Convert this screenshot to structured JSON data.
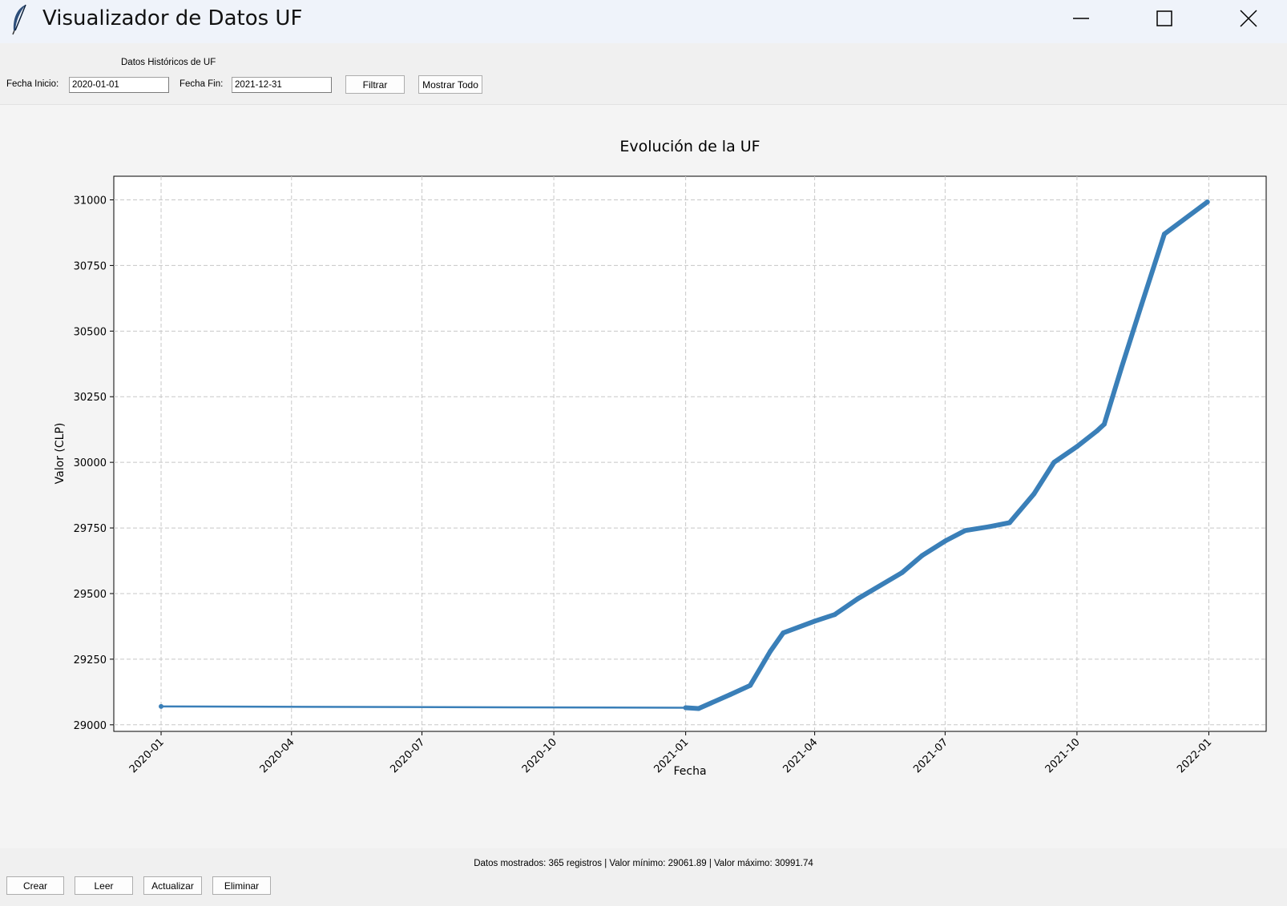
{
  "window": {
    "title": "Visualizador de Datos UF",
    "icon": "feather-icon",
    "controls": [
      "minimize-icon",
      "maximize-icon",
      "close-icon"
    ]
  },
  "header": {
    "section_label": "Datos Históricos de UF",
    "start_label": "Fecha Inicio:",
    "start_value": "2020-01-01",
    "end_label": "Fecha Fin:",
    "end_value": "2021-12-31",
    "filter_button": "Filtrar",
    "show_all_button": "Mostrar Todo"
  },
  "chart_data": {
    "type": "line",
    "title": "Evolución de la UF",
    "xlabel": "Fecha",
    "ylabel": "Valor (CLP)",
    "x_ticks": [
      "2020-01",
      "2020-04",
      "2020-07",
      "2020-10",
      "2021-01",
      "2021-04",
      "2021-07",
      "2021-10",
      "2022-01"
    ],
    "y_ticks": [
      29000,
      29250,
      29500,
      29750,
      30000,
      30250,
      30500,
      30750,
      31000
    ],
    "ylim": [
      28975,
      31090
    ],
    "xlim": [
      "2019-11-29",
      "2022-02-10"
    ],
    "grid": true,
    "color": "#3a7fb8",
    "series": [
      {
        "points": [
          [
            "2020-01-01",
            29070
          ],
          [
            "2021-01-01",
            29065
          ],
          [
            "2021-01-10",
            29062
          ],
          [
            "2021-02-01",
            29115
          ],
          [
            "2021-02-15",
            29150
          ],
          [
            "2021-03-01",
            29280
          ],
          [
            "2021-03-10",
            29350
          ],
          [
            "2021-04-01",
            29395
          ],
          [
            "2021-04-15",
            29420
          ],
          [
            "2021-05-01",
            29480
          ],
          [
            "2021-06-01",
            29580
          ],
          [
            "2021-06-15",
            29645
          ],
          [
            "2021-07-01",
            29700
          ],
          [
            "2021-07-15",
            29740
          ],
          [
            "2021-08-01",
            29755
          ],
          [
            "2021-08-15",
            29770
          ],
          [
            "2021-09-01",
            29880
          ],
          [
            "2021-09-15",
            30000
          ],
          [
            "2021-10-01",
            30060
          ],
          [
            "2021-10-15",
            30120
          ],
          [
            "2021-10-20",
            30145
          ],
          [
            "2021-11-01",
            30360
          ],
          [
            "2021-11-15",
            30600
          ],
          [
            "2021-12-01",
            30870
          ],
          [
            "2021-12-31",
            30992
          ]
        ]
      }
    ]
  },
  "status": {
    "text": "Datos mostrados: 365 registros | Valor mínimo: 29061.89 | Valor máximo: 30991.74"
  },
  "crud": {
    "create": "Crear",
    "read": "Leer",
    "update": "Actualizar",
    "delete": "Eliminar"
  }
}
